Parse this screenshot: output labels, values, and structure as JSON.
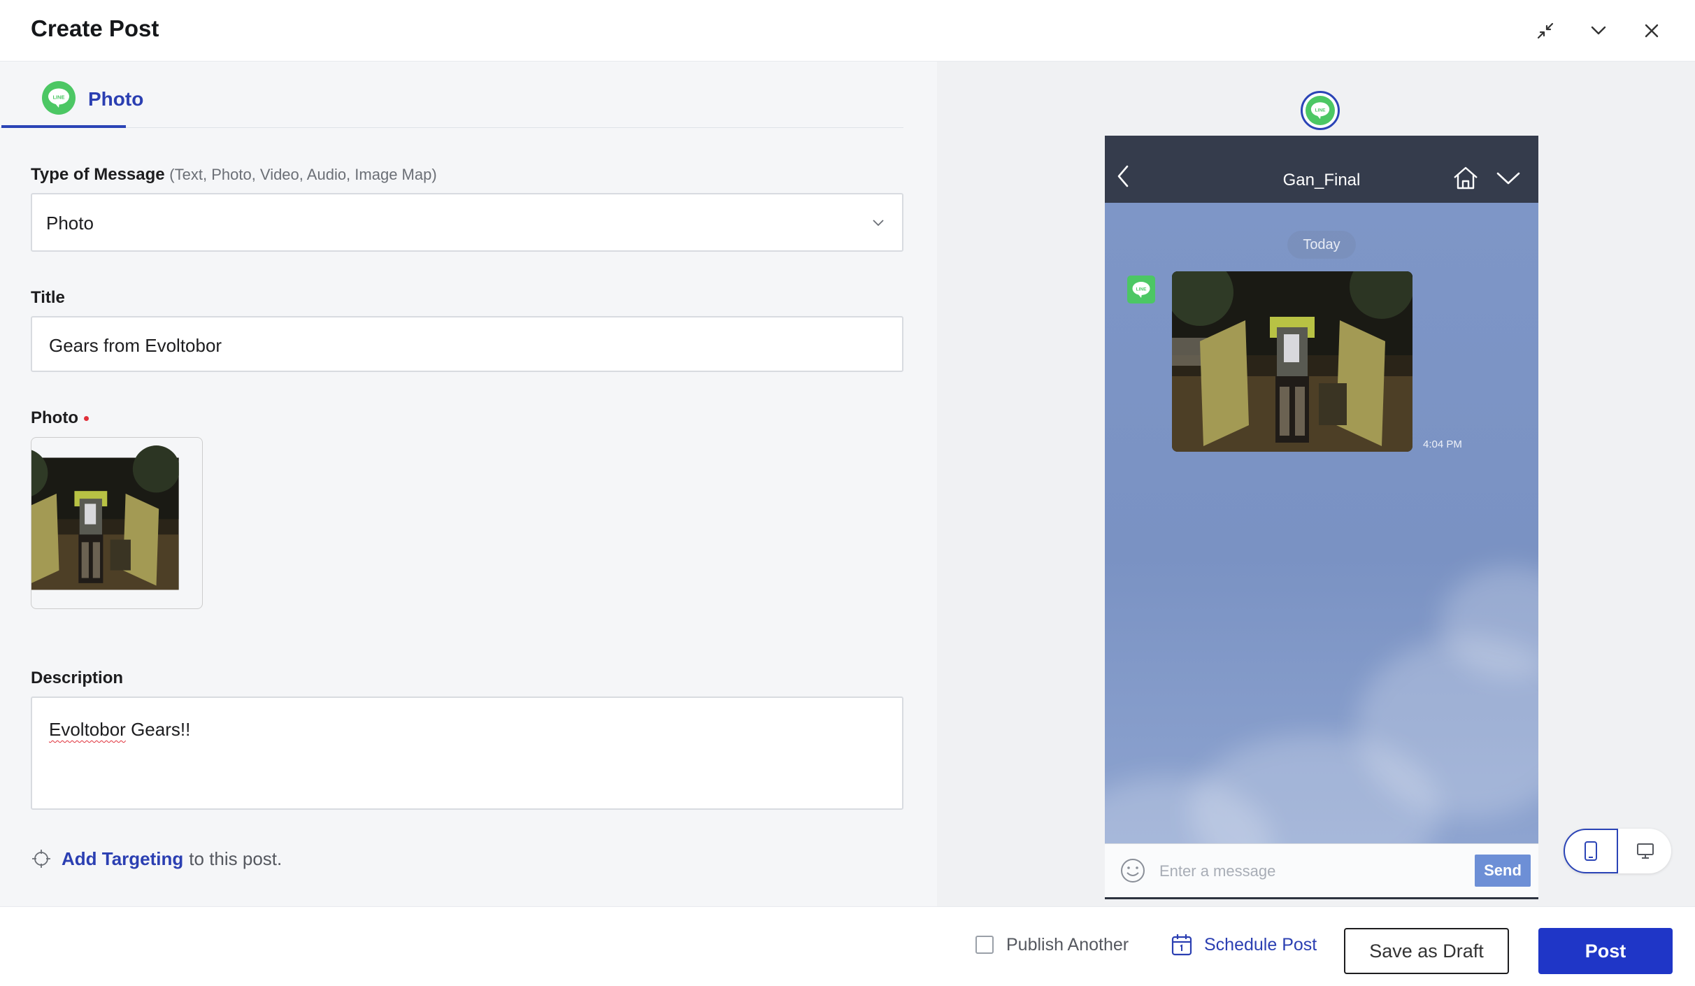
{
  "header": {
    "title": "Create Post",
    "icons": [
      "minimize-icon",
      "chevron-down-icon",
      "close-icon"
    ]
  },
  "tab": {
    "label": "Photo",
    "icon": "line-logo-icon"
  },
  "form": {
    "message_type": {
      "label": "Type of Message",
      "hint": "(Text, Photo, Video, Audio, Image Map)",
      "value": "Photo"
    },
    "title": {
      "label": "Title",
      "value": "Gears from Evoltobor"
    },
    "photo": {
      "label": "Photo",
      "required": true
    },
    "description": {
      "label": "Description",
      "value_part1": "Evoltobor",
      "value_part2": " Gears!!"
    },
    "targeting": {
      "link": "Add Targeting",
      "suffix": "to this post."
    }
  },
  "preview": {
    "chat_name": "Gan_Final",
    "date_pill": "Today",
    "time": "4:04 PM",
    "input_placeholder": "Enter a message",
    "send_label": "Send",
    "active_device": "mobile"
  },
  "footer": {
    "publish_another": "Publish Another",
    "publish_another_checked": false,
    "schedule": "Schedule Post",
    "save_draft": "Save as Draft",
    "post": "Post"
  },
  "colors": {
    "brand_blue": "#1f36c7",
    "link_blue": "#2b3fb2",
    "line_green": "#4cc764",
    "chat_header": "#353c4c",
    "chat_bg": "#7e96c7"
  }
}
